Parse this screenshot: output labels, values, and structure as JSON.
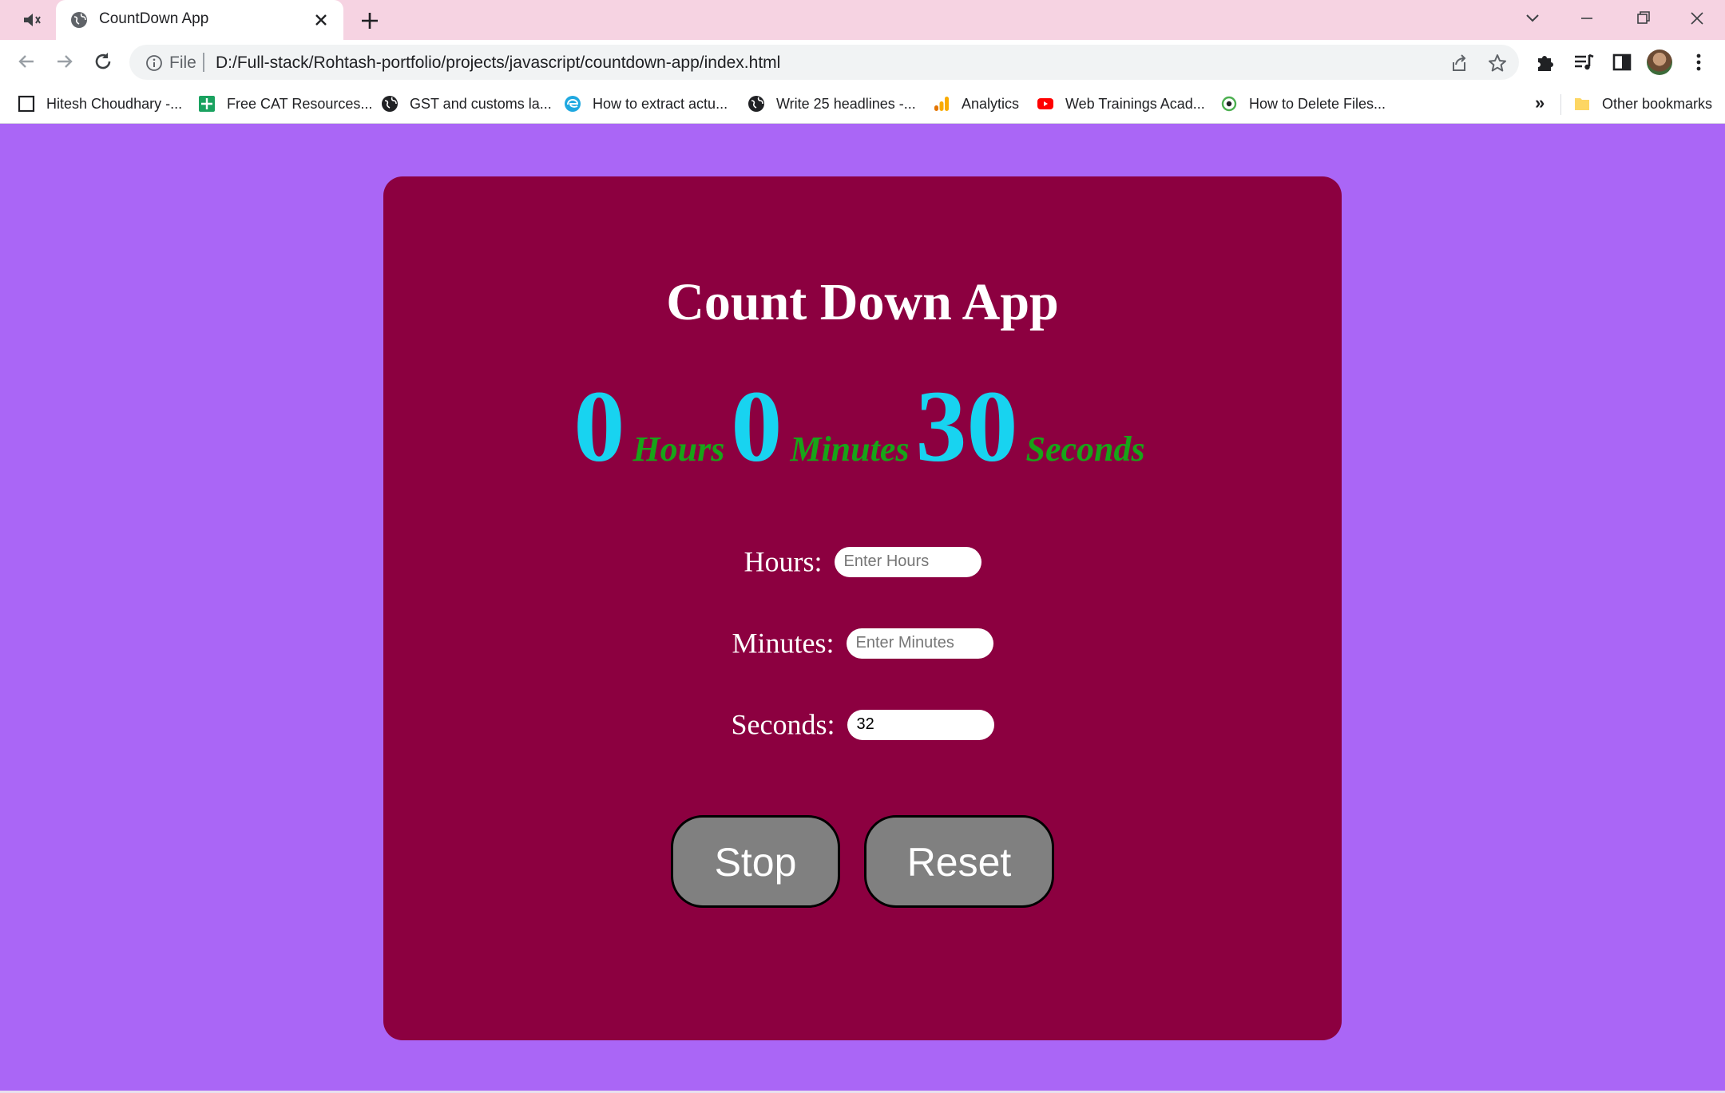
{
  "browser": {
    "tab": {
      "title": "CountDown App"
    },
    "address": {
      "scheme": "File",
      "url": "D:/Full-stack/Rohtash-portfolio/projects/javascript/countdown-app/index.html"
    },
    "bookmarks": [
      {
        "label": "Hitesh Choudhary -...",
        "icon": "checkbox-icon"
      },
      {
        "label": "Free CAT Resources...",
        "icon": "sheets-icon"
      },
      {
        "label": "GST and customs la...",
        "icon": "globe-icon"
      },
      {
        "label": "How to extract actu...",
        "icon": "edge-icon"
      },
      {
        "label": "Write 25 headlines -...",
        "icon": "globe-icon"
      },
      {
        "label": "Analytics",
        "icon": "analytics-icon"
      },
      {
        "label": "Web Trainings Acad...",
        "icon": "youtube-icon"
      },
      {
        "label": "How to Delete Files...",
        "icon": "target-icon"
      }
    ],
    "bookmarks_more": "»",
    "other_bookmarks": "Other bookmarks"
  },
  "app": {
    "title": "Count Down App",
    "timer": {
      "hours": "0",
      "hours_label": "Hours",
      "minutes": "0",
      "minutes_label": "Minutes",
      "seconds": "30",
      "seconds_label": "Seconds"
    },
    "fields": {
      "hours": {
        "label": "Hours:",
        "placeholder": "Enter Hours",
        "value": ""
      },
      "minutes": {
        "label": "Minutes:",
        "placeholder": "Enter Minutes",
        "value": ""
      },
      "seconds": {
        "label": "Seconds:",
        "placeholder": "",
        "value": "32"
      }
    },
    "buttons": {
      "stop": "Stop",
      "reset": "Reset"
    }
  },
  "colors": {
    "page_bg": "#aa66f6",
    "card_bg": "#8c0040",
    "timer_number": "#18d3f0",
    "timer_unit": "#18a418",
    "button_bg": "#808080",
    "tabstrip_bg": "#f6d3e2"
  }
}
